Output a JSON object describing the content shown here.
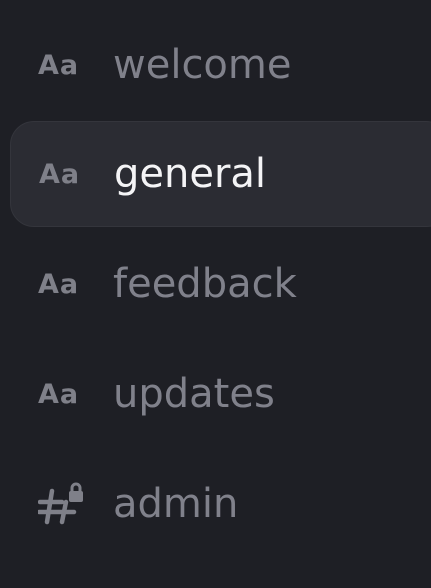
{
  "channels": [
    {
      "label": "welcome",
      "icon": "forum-icon",
      "icon_text": "Aa",
      "selected": false
    },
    {
      "label": "general",
      "icon": "forum-icon",
      "icon_text": "Aa",
      "selected": true
    },
    {
      "label": "feedback",
      "icon": "forum-icon",
      "icon_text": "Aa",
      "selected": false
    },
    {
      "label": "updates",
      "icon": "forum-icon",
      "icon_text": "Aa",
      "selected": false
    },
    {
      "label": "admin",
      "icon": "locked-hash-icon",
      "selected": false
    }
  ],
  "colors": {
    "background": "#1e1f25",
    "selected_background": "#2b2c33",
    "text_muted": "#80818b",
    "text_selected": "#f4f4f6"
  }
}
